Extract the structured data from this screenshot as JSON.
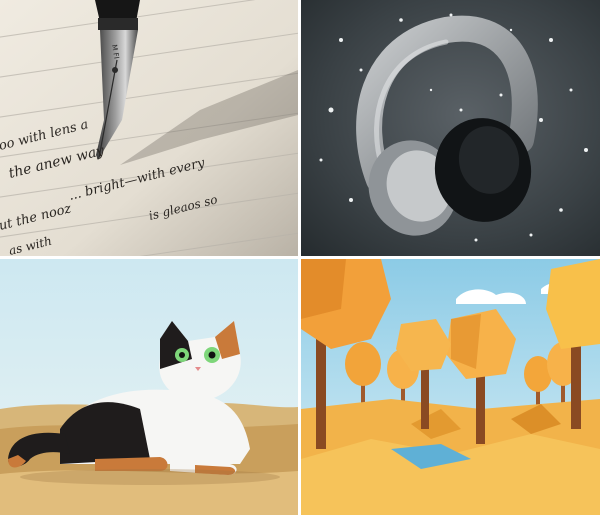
{
  "images": [
    {
      "id": "pen",
      "subject": "fountain-pen-writing"
    },
    {
      "id": "headphones",
      "subject": "painted-headphones"
    },
    {
      "id": "cat",
      "subject": "calico-cat-illustration"
    },
    {
      "id": "trees",
      "subject": "low-poly-autumn-forest"
    }
  ],
  "pen_tile": {
    "nib_imprint": "M FI",
    "handwriting_lines": [
      "the anew way",
      "oo with lens a",
      "... bright—with every",
      "ut the nooz",
      "is gleaos so",
      "as with"
    ]
  },
  "colors": {
    "paper": "#e9e4d9",
    "slate": "#3b4247",
    "sky": "#bfe0ea",
    "sand": "#d9ac6a",
    "autumn": "#f3a63a"
  }
}
